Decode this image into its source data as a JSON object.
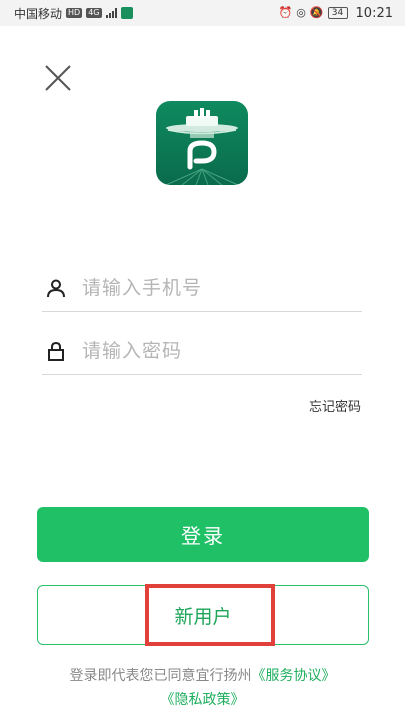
{
  "status_bar": {
    "carrier": "中国移动",
    "network_badge": "HD",
    "signal_label": "4G",
    "battery": "34",
    "time": "10:21"
  },
  "login": {
    "phone_placeholder": "请输入手机号",
    "password_placeholder": "请输入密码",
    "forgot_label": "忘记密码",
    "login_label": "登录",
    "register_label": "新用户"
  },
  "agreement": {
    "prefix": "登录即代表您已同意宜行扬州",
    "service_link": "《服务协议》",
    "privacy_link": "《隐私政策》"
  },
  "colors": {
    "primary": "#20c067",
    "logo": "#0f8a5f",
    "highlight": "#e0423b"
  },
  "icons": {
    "close": "close-icon",
    "user": "user-icon",
    "lock": "lock-icon",
    "logo": "app-logo"
  }
}
